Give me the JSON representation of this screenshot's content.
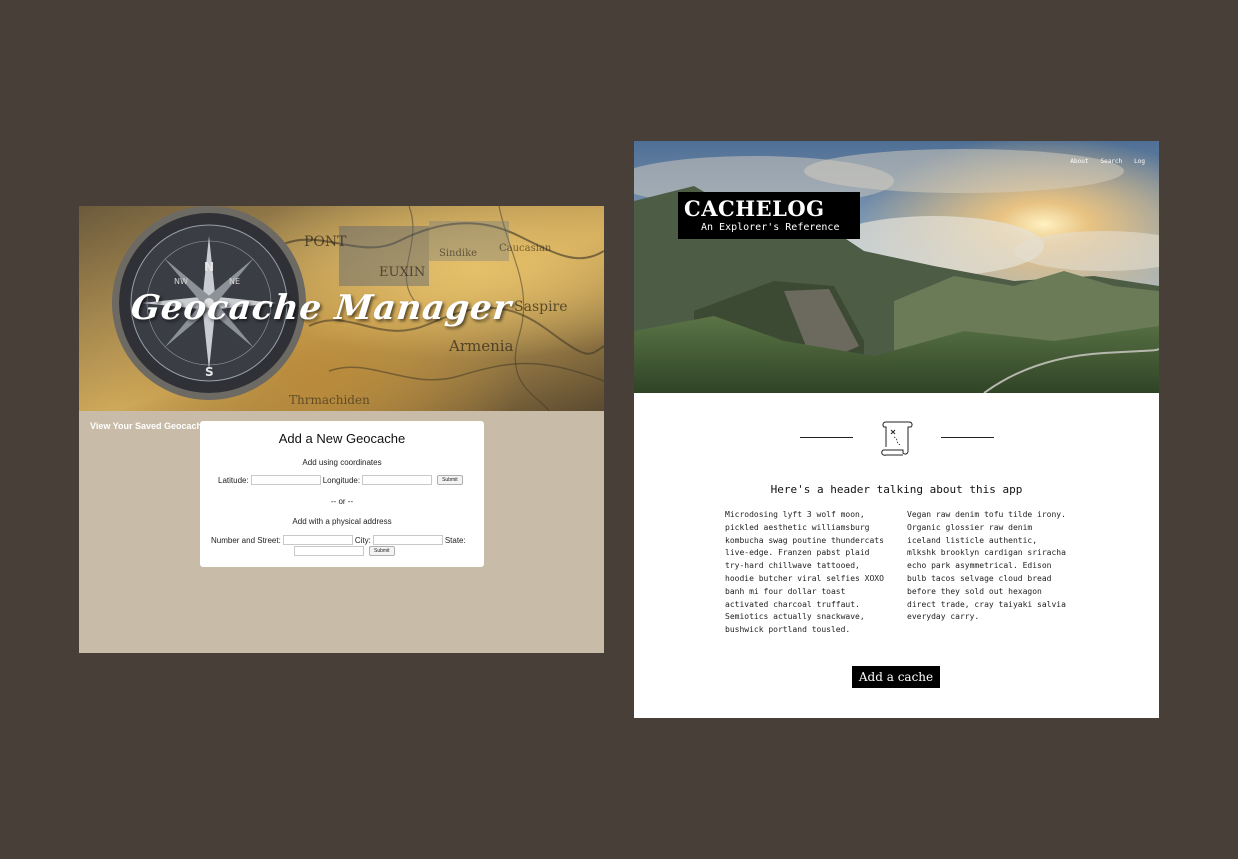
{
  "geocache_manager": {
    "title": "Geocache Manager",
    "saved_link": "View Your Saved Geocaches",
    "form": {
      "title": "Add a New Geocache",
      "coords_subtitle": "Add using coordinates",
      "latitude_label": "Latitude:",
      "longitude_label": "Longitude:",
      "submit_label": "Submit",
      "or_text": "-- or --",
      "address_subtitle": "Add with a physical address",
      "street_label": "Number and Street:",
      "city_label": "City:",
      "state_label": "State:",
      "latitude_value": "",
      "longitude_value": "",
      "street_value": "",
      "city_value": "",
      "state_value": "",
      "zip_value": ""
    },
    "colors": {
      "body_bg": "#c8bca8",
      "form_bg": "#ffffff"
    }
  },
  "cachelog": {
    "nav": [
      "About",
      "Search",
      "Log"
    ],
    "logo_title": "CACHELOG",
    "logo_subtitle": "An Explorer's Reference",
    "section_icon": "treasure-map-scroll-icon",
    "header": "Here's a header talking about this app",
    "col_left": "Microdosing lyft 3 wolf moon, pickled aesthetic williamsburg kombucha swag poutine thundercats live-edge. Franzen pabst plaid try-hard chillwave tattooed, hoodie butcher viral selfies XOXO banh mi four dollar toast activated charcoal truffaut. Semiotics actually snackwave, bushwick portland tousled.",
    "col_right": "Vegan raw denim tofu tilde irony. Organic glossier raw denim iceland listicle authentic, mlkshk brooklyn cardigan sriracha echo park asymmetrical. Edison bulb tacos selvage cloud bread before they sold out hexagon direct trade, cray taiyaki salvia everyday carry.",
    "cta": "Add a cache"
  },
  "colors": {
    "page_bg": "#473f38",
    "accent": "#000000"
  }
}
